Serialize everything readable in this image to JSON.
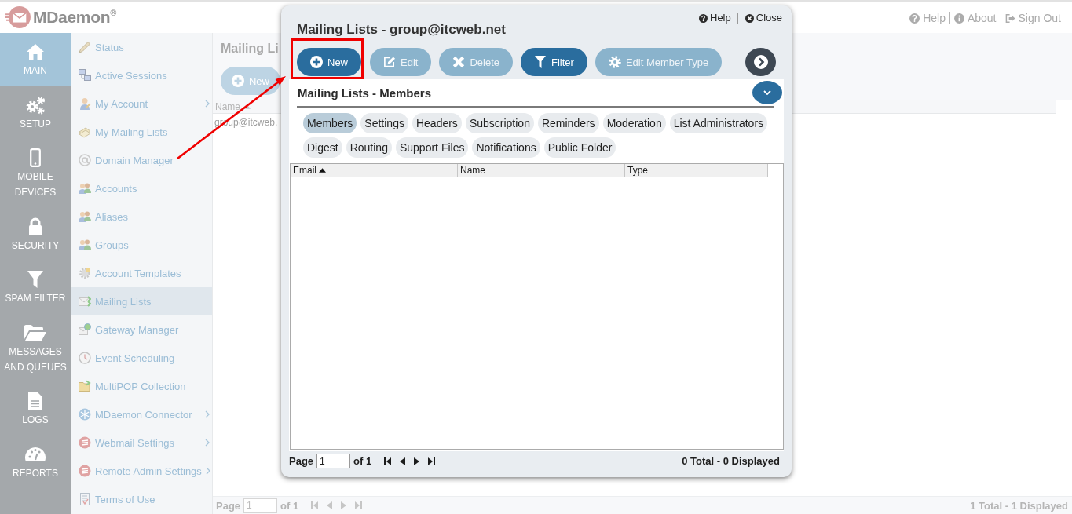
{
  "header": {
    "logo": "MDaemon$^{®}$",
    "links": [
      {
        "kind": "help",
        "label": "Help"
      },
      {
        "kind": "about",
        "label": "About"
      },
      {
        "kind": "signout",
        "label": "Sign Out"
      }
    ]
  },
  "main_nav": [
    {
      "label": "MAIN",
      "selected": true
    },
    {
      "label": "SETUP",
      "selected": false
    },
    {
      "label": "MOBILE DEVICES",
      "selected": false
    },
    {
      "label": "SECURITY",
      "selected": false
    },
    {
      "label": "SPAM FILTER",
      "selected": false
    },
    {
      "label": "MESSAGES AND QUEUES",
      "selected": false
    },
    {
      "label": "LOGS",
      "selected": false
    },
    {
      "label": "REPORTS",
      "selected": false
    }
  ],
  "sub_nav": [
    {
      "label": "Status",
      "selected": false,
      "has_submenu": false
    },
    {
      "label": "Active Sessions",
      "selected": false,
      "has_submenu": false
    },
    {
      "label": "My Account",
      "selected": false,
      "has_submenu": true
    },
    {
      "label": "My Mailing Lists",
      "selected": false,
      "has_submenu": false
    },
    {
      "label": "Domain Manager",
      "selected": false,
      "has_submenu": false
    },
    {
      "label": "Accounts",
      "selected": false,
      "has_submenu": false
    },
    {
      "label": "Aliases",
      "selected": false,
      "has_submenu": false
    },
    {
      "label": "Groups",
      "selected": false,
      "has_submenu": false
    },
    {
      "label": "Account Templates",
      "selected": false,
      "has_submenu": false
    },
    {
      "label": "Mailing Lists",
      "selected": true,
      "has_submenu": false
    },
    {
      "label": "Gateway Manager",
      "selected": false,
      "has_submenu": false
    },
    {
      "label": "Event Scheduling",
      "selected": false,
      "has_submenu": false
    },
    {
      "label": "MultiPOP Collection",
      "selected": false,
      "has_submenu": false
    },
    {
      "label": "MDaemon Connector",
      "selected": false,
      "has_submenu": true
    },
    {
      "label": "Webmail Settings",
      "selected": false,
      "has_submenu": true
    },
    {
      "label": "Remote Admin Settings",
      "selected": false,
      "has_submenu": true
    },
    {
      "label": "Terms of Use",
      "selected": false,
      "has_submenu": false
    }
  ],
  "page": {
    "title": "Mailing Li",
    "new_button": "New",
    "table": {
      "columns": [
        {
          "label": "Name",
          "sorted": true
        }
      ],
      "rows": [
        [
          "group@itcweb."
        ]
      ]
    },
    "pager": {
      "page_label": "Page",
      "page_value": "1",
      "of_label": "of 1",
      "summary": "1 Total - 1 Displayed"
    }
  },
  "annotation_arrow": true,
  "dialog": {
    "help": "Help",
    "close": "Close",
    "title": "Mailing Lists - group@itcweb.net",
    "toolbar": [
      {
        "kind": "new",
        "label": "New",
        "disabled": false,
        "highlighted": true
      },
      {
        "kind": "edit",
        "label": "Edit",
        "disabled": true,
        "highlighted": false
      },
      {
        "kind": "delete",
        "label": "Delete",
        "disabled": true,
        "highlighted": false
      },
      {
        "kind": "filter",
        "label": "Filter",
        "disabled": false,
        "highlighted": false
      },
      {
        "kind": "member_type",
        "label": "Edit Member Type",
        "disabled": true,
        "highlighted": false
      }
    ],
    "section_title": "Mailing Lists - Members",
    "tabs": [
      {
        "label": "Members",
        "selected": true
      },
      {
        "label": "Settings",
        "selected": false
      },
      {
        "label": "Headers",
        "selected": false
      },
      {
        "label": "Subscription",
        "selected": false
      },
      {
        "label": "Reminders",
        "selected": false
      },
      {
        "label": "Moderation",
        "selected": false
      },
      {
        "label": "List Administrators",
        "selected": false
      },
      {
        "label": "Digest",
        "selected": false
      },
      {
        "label": "Routing",
        "selected": false
      },
      {
        "label": "Support Files",
        "selected": false
      },
      {
        "label": "Notifications",
        "selected": false
      },
      {
        "label": "Public Folder",
        "selected": false
      }
    ],
    "grid": {
      "columns": [
        {
          "label": "Email",
          "sorted": true
        },
        {
          "label": "Name",
          "sorted": false
        },
        {
          "label": "Type",
          "sorted": false
        }
      ]
    },
    "pager": {
      "page_label": "Page",
      "page_value": "1",
      "of_label": "of 1",
      "summary": "0 Total - 0 Displayed"
    }
  }
}
